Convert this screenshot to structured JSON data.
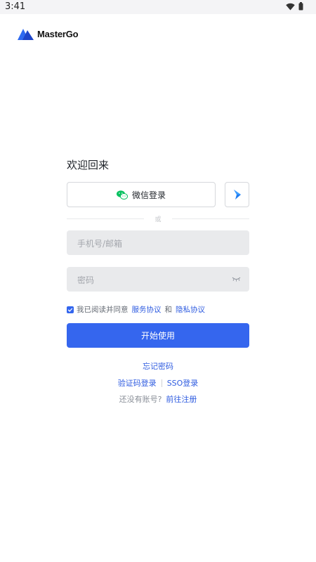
{
  "status_bar": {
    "time": "3:41"
  },
  "brand": {
    "name": "MasterGo"
  },
  "login": {
    "welcome": "欢迎回来",
    "wechat_label": "微信登录",
    "divider_text": "或",
    "phone_email_placeholder": "手机号/邮箱",
    "password_placeholder": "密码",
    "agree_prefix": "我已阅读并同意",
    "service_agreement": "服务协议",
    "and": "和",
    "privacy_agreement": "隐私协议",
    "start_button": "开始使用",
    "forgot_password": "忘记密码",
    "code_login": "验证码登录",
    "sso_login": "SSO登录",
    "no_account": "还没有账号?",
    "go_register": "前往注册"
  },
  "colors": {
    "accent": "#3566ee",
    "wechat": "#07c160",
    "feishu": "#1f7cf0"
  }
}
